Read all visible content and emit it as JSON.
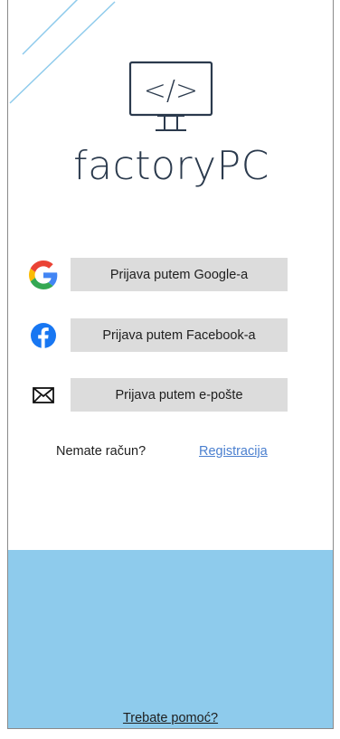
{
  "brand": {
    "name": "factoryPC",
    "logo_glyph": "</>"
  },
  "login": {
    "google_label": "Prijava putem Google-a",
    "facebook_label": "Prijava putem Facebook-a",
    "email_label": "Prijava putem e-pošte"
  },
  "register": {
    "question": "Nemate račun?",
    "link_label": "Registracija"
  },
  "footer": {
    "help_label": "Trebate pomoć?"
  },
  "colors": {
    "accent_blue": "#8ecbec",
    "link_blue": "#4a7fcf",
    "button_gray": "#dcdcdc",
    "facebook_blue": "#1877f2"
  },
  "icons": {
    "google": "google-icon",
    "facebook": "facebook-icon",
    "email": "envelope-icon",
    "logo": "monitor-code-icon"
  }
}
